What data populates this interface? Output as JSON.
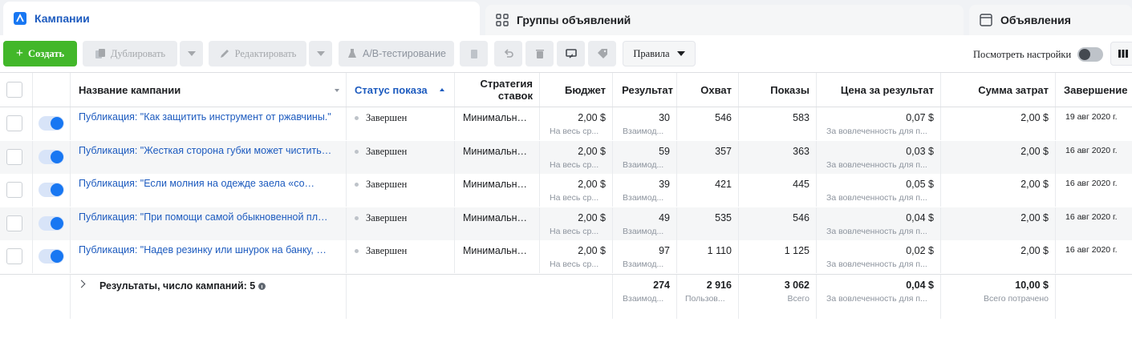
{
  "tabs": [
    {
      "label": "Кампании",
      "icon": "campaign-flag-icon",
      "active": true
    },
    {
      "label": "Группы объявлений",
      "icon": "grid-icon",
      "active": false
    },
    {
      "label": "Объявления",
      "icon": "ad-window-icon",
      "active": false
    }
  ],
  "toolbar": {
    "create_label": "Создать",
    "duplicate_label": "Дублировать",
    "edit_label": "Редактировать",
    "ab_label": "A/B-тестирование",
    "rules_label": "Правила",
    "view_settings_label": "Посмотреть настройки"
  },
  "columns": {
    "name": "Название кампании",
    "status": "Статус показа",
    "strategy": "Стратегия ставок",
    "budget": "Бюджет",
    "results": "Результат",
    "reach": "Охват",
    "impressions": "Показы",
    "cost_per_result": "Цена за результат",
    "spent": "Сумма затрат",
    "end": "Завершение"
  },
  "rows": [
    {
      "name": "Публикация: \"Как защитить инструмент от ржавчины.\"",
      "status": "Завершен",
      "strategy": "Минимальн…",
      "budget": "2,00 $",
      "budget_sub": "На весь ср...",
      "results": "30",
      "results_sub": "Взаимод...",
      "reach": "546",
      "impressions": "583",
      "cost": "0,07 $",
      "cost_sub": "За вовлеченность для п...",
      "spent": "2,00 $",
      "end": "19 авг 2020 г."
    },
    {
      "name": "Публикация: \"Жесткая сторона губки может чистить…",
      "status": "Завершен",
      "strategy": "Минимальн…",
      "budget": "2,00 $",
      "budget_sub": "На весь ср...",
      "results": "59",
      "results_sub": "Взаимод...",
      "reach": "357",
      "impressions": "363",
      "cost": "0,03 $",
      "cost_sub": "За вовлеченность для п...",
      "spent": "2,00 $",
      "end": "16 авг 2020 г."
    },
    {
      "name": "Публикация: \"Если молния на одежде заела «со…",
      "status": "Завершен",
      "strategy": "Минимальн…",
      "budget": "2,00 $",
      "budget_sub": "На весь ср...",
      "results": "39",
      "results_sub": "Взаимод...",
      "reach": "421",
      "impressions": "445",
      "cost": "0,05 $",
      "cost_sub": "За вовлеченность для п...",
      "spent": "2,00 $",
      "end": "16 авг 2020 г."
    },
    {
      "name": "Публикация: \"При помощи самой обыкновенной пл…",
      "status": "Завершен",
      "strategy": "Минимальн…",
      "budget": "2,00 $",
      "budget_sub": "На весь ср...",
      "results": "49",
      "results_sub": "Взаимод...",
      "reach": "535",
      "impressions": "546",
      "cost": "0,04 $",
      "cost_sub": "За вовлеченность для п...",
      "spent": "2,00 $",
      "end": "16 авг 2020 г."
    },
    {
      "name": "Публикация: \"Надев резинку или шнурок на банку, …",
      "status": "Завершен",
      "strategy": "Минимальн…",
      "budget": "2,00 $",
      "budget_sub": "На весь ср...",
      "results": "97",
      "results_sub": "Взаимод...",
      "reach": "1 110",
      "impressions": "1 125",
      "cost": "0,02 $",
      "cost_sub": "За вовлеченность для п...",
      "spent": "2,00 $",
      "end": "16 авг 2020 г."
    }
  ],
  "totals": {
    "label": "Результаты, число кампаний: 5",
    "results": "274",
    "results_sub": "Взаимод...",
    "reach": "2 916",
    "reach_sub": "Пользов...",
    "impressions": "3 062",
    "impressions_sub": "Всего",
    "cost": "0,04 $",
    "cost_sub": "За вовлеченность для п...",
    "spent": "10,00 $",
    "spent_sub": "Всего потрачено"
  },
  "colors": {
    "accent": "#1d5bbf",
    "create": "#42b72a",
    "toggle": "#1877f2"
  }
}
